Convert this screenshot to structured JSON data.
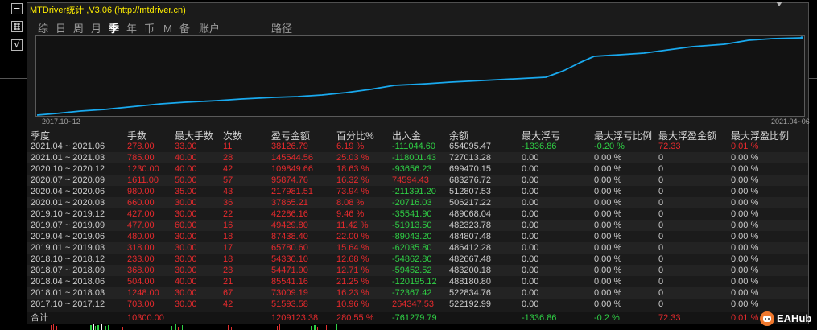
{
  "window": {
    "title": "MTDriver统计 ,V3.06 (http://mtdriver.cn)",
    "dropdown_icon": "triangle-down-icon"
  },
  "side_buttons": {
    "minimize_label": "−",
    "tool_icon": "tool-icon",
    "check_label": "√"
  },
  "tabs": [
    {
      "label": "综"
    },
    {
      "label": "日"
    },
    {
      "label": "周"
    },
    {
      "label": "月"
    },
    {
      "label": "季",
      "active": true
    },
    {
      "label": "年"
    },
    {
      "label": "币"
    },
    {
      "label": "M"
    },
    {
      "label": "备"
    },
    {
      "label": "账户"
    },
    {
      "label": "路径"
    }
  ],
  "equity_chart": {
    "start_label": "2017.10~12",
    "end_label": "2021.04~06",
    "line_color": "#19a9ee"
  },
  "table": {
    "headers": [
      "季度",
      "手数",
      "最大手数",
      "次数",
      "盈亏金额",
      "百分比%",
      "出入金",
      "余额",
      "最大浮亏",
      "最大浮亏比例",
      "最大浮盈金额",
      "最大浮盈比例"
    ],
    "rows": [
      [
        "2021.04 ~ 2021.06",
        "278.00",
        "33.00",
        "11",
        "38126.79",
        "6.19 %",
        "-111044.60",
        "654095.47",
        "-1336.86",
        "-0.20 %",
        "72.33",
        "0.01 %"
      ],
      [
        "2021.01 ~ 2021.03",
        "785.00",
        "40.00",
        "28",
        "145544.56",
        "25.03 %",
        "-118001.43",
        "727013.28",
        "0.00",
        "0.00 %",
        "0",
        "0.00 %"
      ],
      [
        "2020.10 ~ 2020.12",
        "1230.00",
        "40.00",
        "42",
        "109849.66",
        "18.63 %",
        "-93656.23",
        "699470.15",
        "0.00",
        "0.00 %",
        "0",
        "0.00 %"
      ],
      [
        "2020.07 ~ 2020.09",
        "1611.00",
        "50.00",
        "57",
        "95874.76",
        "16.32 %",
        "74594.43",
        "683276.72",
        "0.00",
        "0.00 %",
        "0",
        "0.00 %"
      ],
      [
        "2020.04 ~ 2020.06",
        "980.00",
        "35.00",
        "43",
        "217981.51",
        "73.94 %",
        "-211391.20",
        "512807.53",
        "0.00",
        "0.00 %",
        "0",
        "0.00 %"
      ],
      [
        "2020.01 ~ 2020.03",
        "660.00",
        "30.00",
        "36",
        "37865.21",
        "8.08 %",
        "-20716.03",
        "506217.22",
        "0.00",
        "0.00 %",
        "0",
        "0.00 %"
      ],
      [
        "2019.10 ~ 2019.12",
        "427.00",
        "30.00",
        "22",
        "42286.16",
        "9.46 %",
        "-35541.90",
        "489068.04",
        "0.00",
        "0.00 %",
        "0",
        "0.00 %"
      ],
      [
        "2019.07 ~ 2019.09",
        "477.00",
        "60.00",
        "16",
        "49429.80",
        "11.42 %",
        "-51913.50",
        "482323.78",
        "0.00",
        "0.00 %",
        "0",
        "0.00 %"
      ],
      [
        "2019.04 ~ 2019.06",
        "480.00",
        "30.00",
        "18",
        "87438.40",
        "22.00 %",
        "-89043.20",
        "484807.48",
        "0.00",
        "0.00 %",
        "0",
        "0.00 %"
      ],
      [
        "2019.01 ~ 2019.03",
        "318.00",
        "30.00",
        "17",
        "65780.60",
        "15.64 %",
        "-62035.80",
        "486412.28",
        "0.00",
        "0.00 %",
        "0",
        "0.00 %"
      ],
      [
        "2018.10 ~ 2018.12",
        "233.00",
        "30.00",
        "18",
        "54330.10",
        "12.68 %",
        "-54862.80",
        "482667.48",
        "0.00",
        "0.00 %",
        "0",
        "0.00 %"
      ],
      [
        "2018.07 ~ 2018.09",
        "368.00",
        "30.00",
        "23",
        "54471.90",
        "12.71 %",
        "-59452.52",
        "483200.18",
        "0.00",
        "0.00 %",
        "0",
        "0.00 %"
      ],
      [
        "2018.04 ~ 2018.06",
        "504.00",
        "40.00",
        "21",
        "85541.16",
        "21.25 %",
        "-120195.12",
        "488180.80",
        "0.00",
        "0.00 %",
        "0",
        "0.00 %"
      ],
      [
        "2018.01 ~ 2018.03",
        "1248.00",
        "30.00",
        "67",
        "73009.19",
        "16.23 %",
        "-72367.42",
        "522834.76",
        "0.00",
        "0.00 %",
        "0",
        "0.00 %"
      ],
      [
        "2017.10 ~ 2017.12",
        "703.00",
        "30.00",
        "42",
        "51593.58",
        "10.96 %",
        "264347.53",
        "522192.99",
        "0.00",
        "0.00 %",
        "0",
        "0.00 %"
      ]
    ],
    "total": [
      "合计",
      "10300.00",
      "",
      "",
      "1209123.38",
      "280.55 %",
      "-761279.79",
      "",
      "-1336.86",
      "-0.2 %",
      "72.33",
      "0.01 %"
    ]
  },
  "colors": {
    "title": "#ffee00",
    "header": "#d6d6d6",
    "positive": "#e62a2d",
    "negative": "#2fd045",
    "neutral": "#cccccc"
  },
  "logo": {
    "text": "EAHub",
    "color": "#f0782d"
  }
}
